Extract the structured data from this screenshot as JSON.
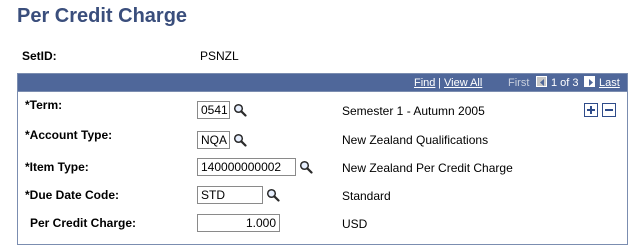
{
  "page": {
    "title": "Per Credit Charge"
  },
  "setid": {
    "label": "SetID:",
    "value": "PSNZL"
  },
  "grid_nav": {
    "find": "Find",
    "separator": "|",
    "view_all": "View All",
    "first": "First",
    "count": "1 of 3",
    "last": "Last"
  },
  "fields": {
    "term": {
      "label": "*Term:",
      "value": "0541",
      "description": "Semester 1 - Autumn 2005"
    },
    "account_type": {
      "label": "*Account Type:",
      "value": "NQA",
      "description": "New Zealand Qualifications"
    },
    "item_type": {
      "label": "*Item Type:",
      "value": "140000000002",
      "description": "New Zealand Per Credit Charge"
    },
    "due_date_code": {
      "label": "*Due Date Code:",
      "value": "STD",
      "description": "Standard"
    },
    "per_credit_charge": {
      "label": "Per Credit Charge:",
      "value": "1.000",
      "description": "USD"
    }
  },
  "icons": {
    "lookup": "magnifier-icon",
    "add_row": "plus-icon",
    "delete_row": "minus-icon",
    "prev": "left-arrow-icon",
    "next": "right-arrow-icon"
  },
  "colors": {
    "title": "#3a4e7c",
    "grid_header": "#4f679a",
    "border": "#7b8db0"
  }
}
